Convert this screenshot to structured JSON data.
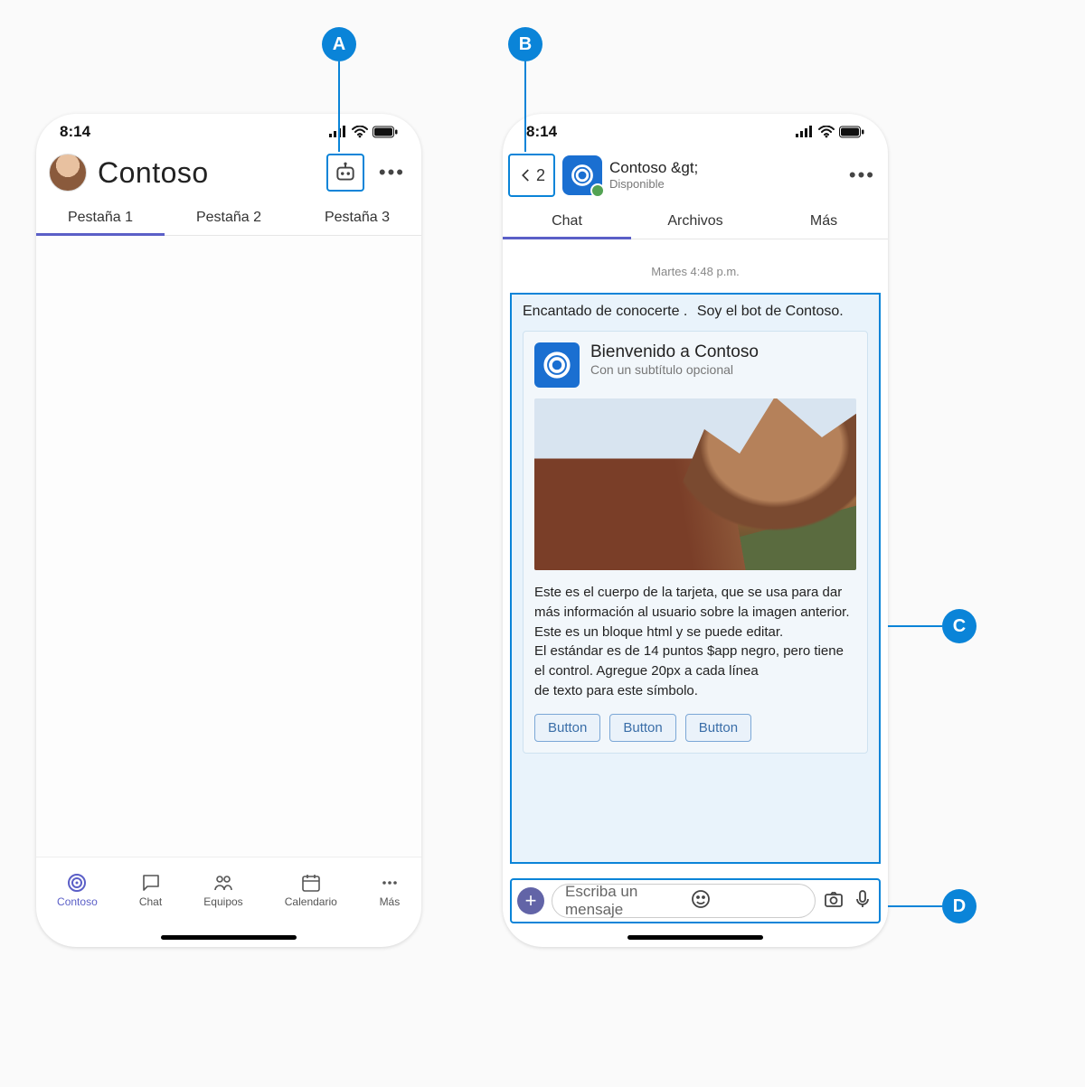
{
  "status": {
    "time": "8:14"
  },
  "callouts": {
    "a": "A",
    "b": "B",
    "c": "C",
    "d": "D"
  },
  "phone_a": {
    "title": "Contoso",
    "tabs": [
      "Pestaña 1",
      "Pestaña 2",
      "Pestaña 3"
    ],
    "nav": {
      "item1": "Contoso",
      "item2": "Chat",
      "item3": "Equipos",
      "item4": "Calendario",
      "item5": "Más"
    }
  },
  "phone_b": {
    "back_count": "2",
    "header": {
      "title": "Contoso &gt;",
      "status": "Disponible"
    },
    "tabs": [
      "Chat",
      "Archivos",
      "Más"
    ],
    "timestamp": "Martes 4:48 p.m.",
    "message": {
      "intro1": "Encantado de conocerte .",
      "intro2": "Soy el bot de Contoso.",
      "card": {
        "title": "Bienvenido a Contoso",
        "subtitle": "Con un subtítulo opcional",
        "body": "Este es el cuerpo de la tarjeta, que se usa para dar más información al usuario sobre la imagen anterior.\nEste es un bloque html y se puede editar.\nEl estándar es de 14 puntos $app negro, pero tiene el control. Agregue 20px a cada línea\nde texto para este símbolo.",
        "buttons": [
          "Button",
          "Button",
          "Button"
        ]
      }
    },
    "compose": {
      "placeholder": "Escriba un mensaje"
    }
  }
}
